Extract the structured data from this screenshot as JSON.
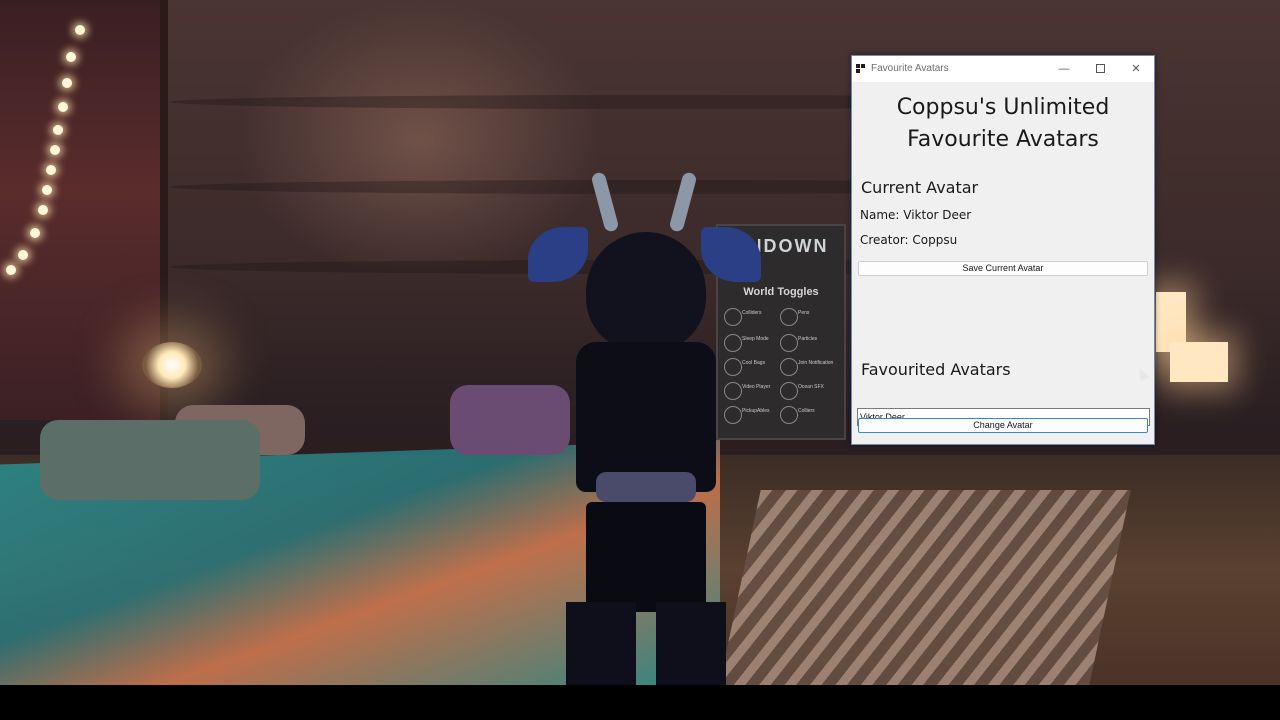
{
  "window": {
    "title": "Favourite Avatars",
    "controls": {
      "minimize": "—",
      "maximize": "",
      "close": "✕"
    }
  },
  "app": {
    "heading_line1": "Coppsu's Unlimited",
    "heading_line2": "Favourite Avatars",
    "current": {
      "section_title": "Current Avatar",
      "name_line": "Name: Viktor Deer",
      "creator_line": "Creator: Coppsu",
      "save_button": "Save Current Avatar"
    },
    "favourites": {
      "section_title": "Favourited Avatars",
      "selected": "Viktor Deer",
      "change_button": "Change Avatar"
    }
  },
  "scene": {
    "board_title": "UNDOWN",
    "board_subtitle": "World Toggles",
    "toggles": [
      "Colliders",
      "Pens",
      "Sleep Mode",
      "Particles",
      "Cool Bags",
      "Join Notification",
      "Video Player",
      "Ocean SFX",
      "PickupAbles",
      "Colliers"
    ]
  },
  "icons": {
    "app_icon": "app-logo-icon",
    "dropdown": "chevron-down-icon",
    "cursor": "mouse-cursor-icon"
  }
}
